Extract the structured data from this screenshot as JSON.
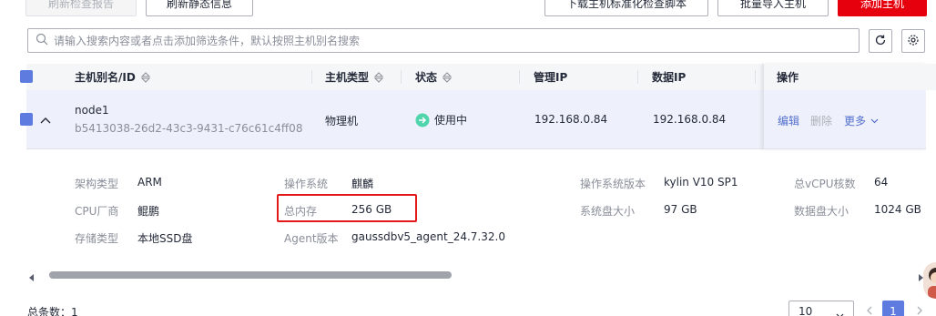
{
  "toolbar": {
    "refresh_report": "刷新检查报告",
    "refresh_static": "刷新静态信息",
    "download_script": "下载主机标准化检查脚本",
    "batch_import": "批量导入主机",
    "add_host": "添加主机"
  },
  "search": {
    "placeholder": "请输入搜索内容或者点击添加筛选条件，默认按照主机别名搜索"
  },
  "table": {
    "headers": {
      "alias": "主机别名/ID",
      "type": "主机类型",
      "status": "状态",
      "mgmt_ip": "管理IP",
      "data_ip": "数据IP",
      "ops": "操作"
    },
    "row": {
      "alias": "node1",
      "id": "b5413038-26d2-43c3-9431-c76c61c4ff08",
      "type": "物理机",
      "status": "使用中",
      "mgmt_ip": "192.168.0.84",
      "data_ip": "192.168.0.84",
      "ops": {
        "edit": "编辑",
        "delete": "删除",
        "more": "更多"
      }
    }
  },
  "details": {
    "arch_label": "架构类型",
    "arch_value": "ARM",
    "cpu_vendor_label": "CPU厂商",
    "cpu_vendor_value": "鲲鹏",
    "storage_label": "存储类型",
    "storage_value": "本地SSD盘",
    "os_label": "操作系统",
    "os_value": "麒麟",
    "mem_label": "总内存",
    "mem_value": "256 GB",
    "agent_label": "Agent版本",
    "agent_value": "gaussdbv5_agent_24.7.32.0",
    "os_ver_label": "操作系统版本",
    "os_ver_value": "kylin V10 SP1",
    "sys_disk_label": "系统盘大小",
    "sys_disk_value": "97 GB",
    "vcpu_label": "总vCPU核数",
    "vcpu_value": "64",
    "data_disk_label": "数据盘大小",
    "data_disk_value": "1024 GB"
  },
  "footer": {
    "total": "总条数：1",
    "page_size": "10",
    "current_page": "1"
  },
  "colors": {
    "primary": "#e6000e",
    "accent": "#5e7ce0",
    "link": "#526ecc",
    "status_green": "#50d4ab",
    "highlight": "#e31919"
  }
}
